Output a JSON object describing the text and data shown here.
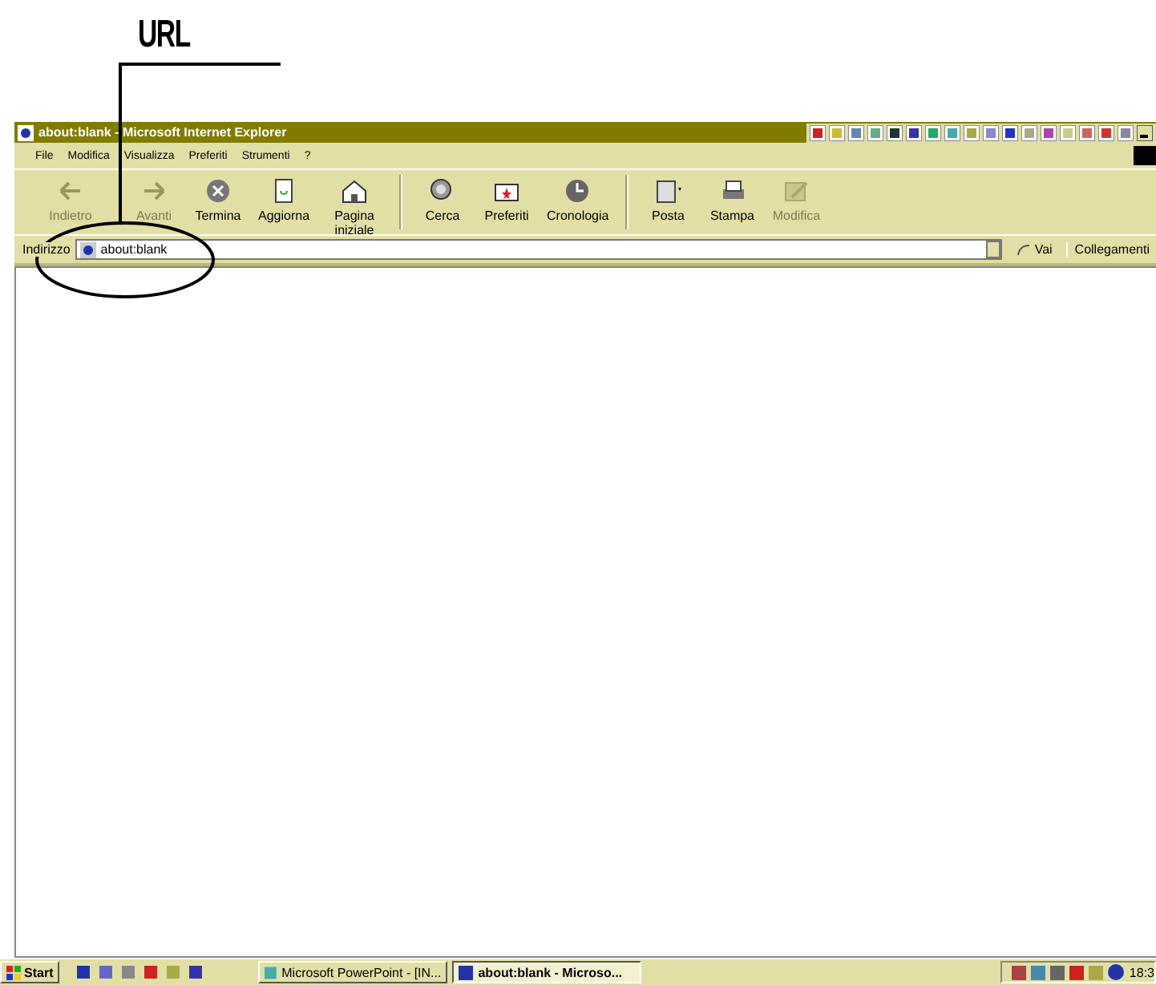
{
  "annotation": {
    "label": "URL"
  },
  "window": {
    "title": "about:blank - Microsoft Internet Explorer"
  },
  "menu": [
    "File",
    "Modifica",
    "Visualizza",
    "Preferiti",
    "Strumenti",
    "?"
  ],
  "toolbar": [
    {
      "kind": "back",
      "label": "Indietro",
      "disabled": true
    },
    {
      "kind": "forward",
      "label": "Avanti",
      "disabled": true
    },
    {
      "kind": "stop",
      "label": "Termina",
      "disabled": false
    },
    {
      "kind": "refresh",
      "label": "Aggiorna",
      "disabled": false
    },
    {
      "kind": "home",
      "label": "Pagina iniziale",
      "disabled": false
    },
    {
      "kind": "separator"
    },
    {
      "kind": "search",
      "label": "Cerca",
      "disabled": false
    },
    {
      "kind": "favorites",
      "label": "Preferiti",
      "disabled": false
    },
    {
      "kind": "history",
      "label": "Cronologia",
      "disabled": false
    },
    {
      "kind": "separator"
    },
    {
      "kind": "mail",
      "label": "Posta",
      "disabled": false
    },
    {
      "kind": "print",
      "label": "Stampa",
      "disabled": false
    },
    {
      "kind": "edit",
      "label": "Modifica",
      "disabled": true
    }
  ],
  "address": {
    "label": "Indirizzo",
    "value": "about:blank",
    "go": "Vai",
    "links": "Collegamenti"
  },
  "taskbar": {
    "start": "Start",
    "tasks": [
      {
        "label": "Microsoft PowerPoint - [IN...",
        "selected": false
      },
      {
        "label": "about:blank - Microso...",
        "selected": true
      }
    ],
    "clock": "18:3"
  }
}
